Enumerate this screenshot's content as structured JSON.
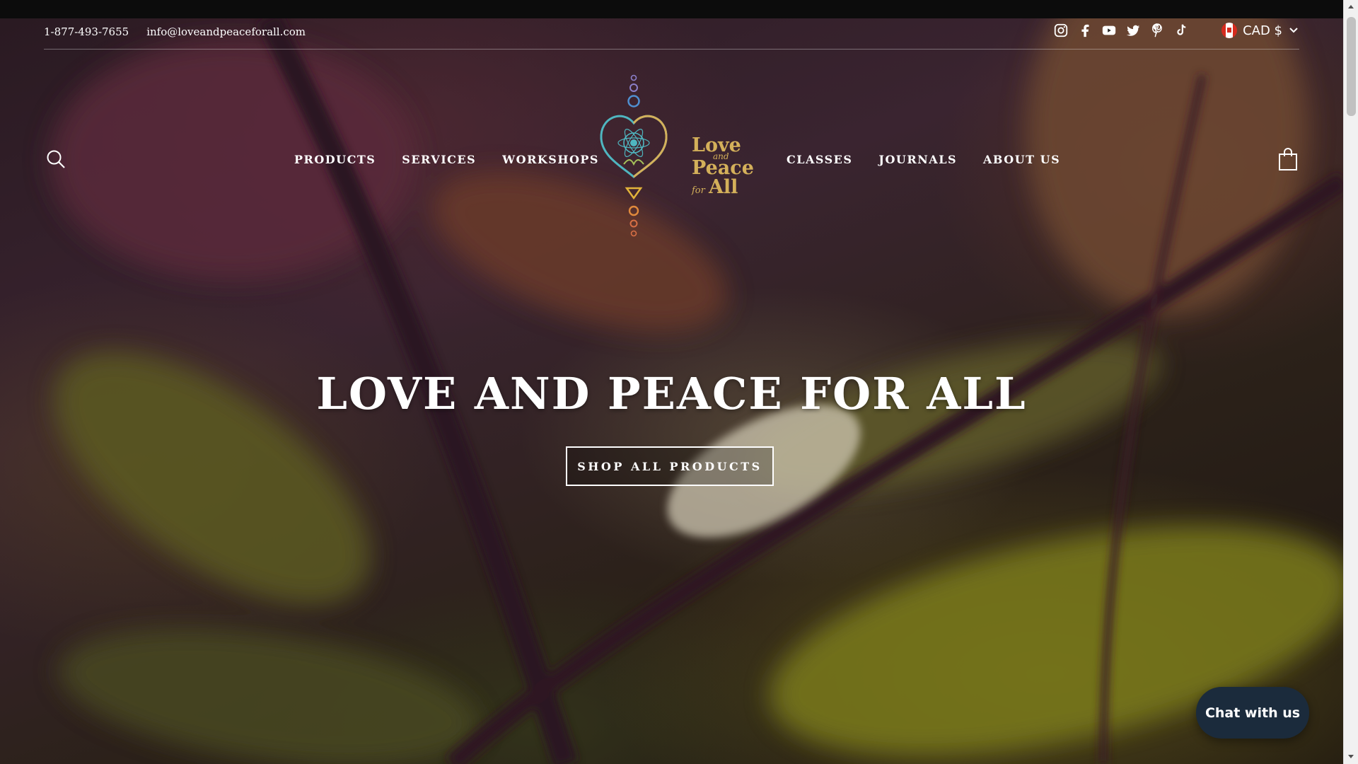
{
  "topbar": {
    "phone": "1-877-493-7655",
    "email": "info@loveandpeaceforall.com",
    "social_icons": [
      "instagram-icon",
      "facebook-icon",
      "youtube-icon",
      "twitter-icon",
      "pinterest-icon",
      "tiktok-icon"
    ],
    "currency": "CAD $",
    "currency_flag": "canada-flag-icon"
  },
  "nav": {
    "left": [
      "PRODUCTS",
      "SERVICES",
      "WORKSHOPS"
    ],
    "right": [
      "CLASSES",
      "JOURNALS",
      "ABOUT US"
    ]
  },
  "logo": {
    "line1": "Love",
    "line2": "and",
    "line3": "Peace",
    "line4": "for",
    "line5": "All"
  },
  "hero": {
    "title": "LOVE AND PEACE FOR ALL",
    "cta": "SHOP ALL PRODUCTS"
  },
  "chat": {
    "label": "Chat with us"
  },
  "colors": {
    "accent_gold": "#d4b05a",
    "logo_teal": "#4fb6c0",
    "chat_bg": "#1b2b3c"
  }
}
